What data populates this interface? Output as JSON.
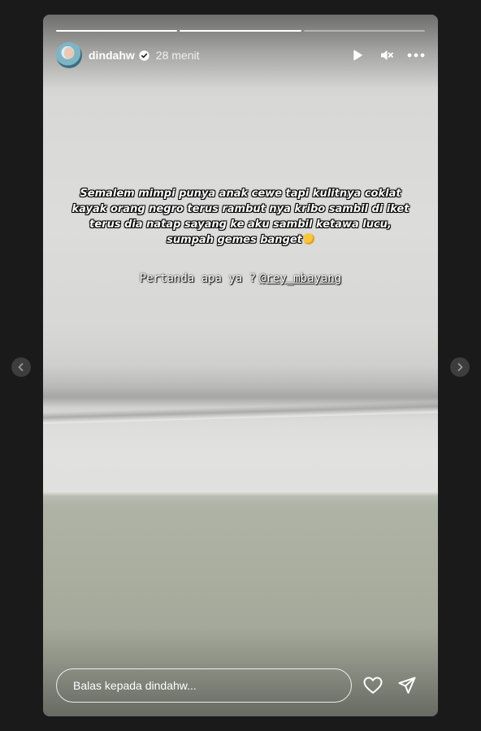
{
  "story": {
    "username": "dindahw",
    "verified": true,
    "time_ago": "28 menit",
    "progress": [
      1.0,
      1.0,
      0.0
    ],
    "caption": "Semalem mimpi punya anak cewe tapi kulitnya coklat kayak orang negro terus rambut nya kribo sambil di iket terus dia natap sayang ke aku sambil ketawa lucu, sumpah gemes banget",
    "question": "Pertanda apa ya ?",
    "mention": "@rey_mbayang"
  },
  "controls": {
    "play_icon": "play-icon",
    "mute_icon": "muted-speaker-icon",
    "more_icon": "more-icon"
  },
  "reply": {
    "placeholder": "Balas kepada dindahw..."
  },
  "colors": {
    "background": "#1a1a1a",
    "text": "#ffffff",
    "arrow_button": "#3d3d3d"
  }
}
